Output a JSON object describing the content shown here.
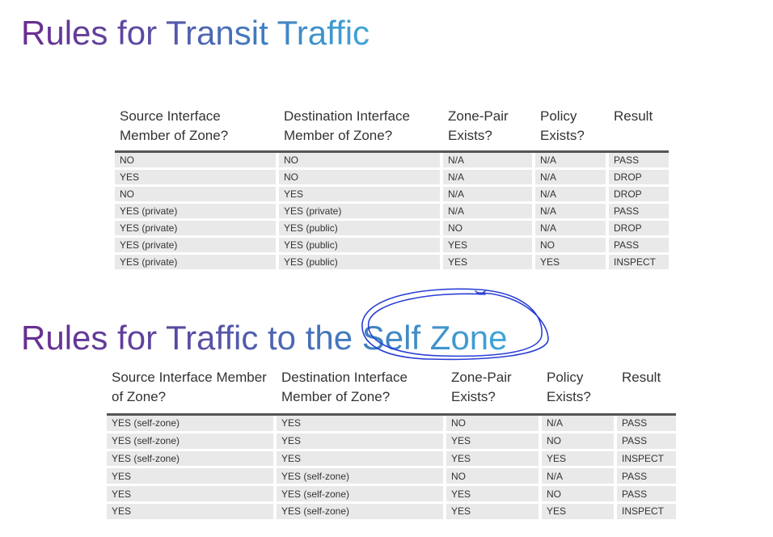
{
  "transit": {
    "title": "Rules for Transit Traffic",
    "headers": [
      "Source Interface Member of Zone?",
      "Destination Interface Member of Zone?",
      "Zone-Pair Exists?",
      "Policy Exists?",
      "Result"
    ],
    "rows": [
      [
        "NO",
        "NO",
        "N/A",
        "N/A",
        "PASS"
      ],
      [
        "YES",
        "NO",
        "N/A",
        "N/A",
        "DROP"
      ],
      [
        "NO",
        "YES",
        "N/A",
        "N/A",
        "DROP"
      ],
      [
        "YES (private)",
        "YES (private)",
        "N/A",
        "N/A",
        "PASS"
      ],
      [
        "YES (private)",
        "YES (public)",
        "NO",
        "N/A",
        "DROP"
      ],
      [
        "YES (private)",
        "YES (public)",
        "YES",
        "NO",
        "PASS"
      ],
      [
        "YES (private)",
        "YES (public)",
        "YES",
        "YES",
        "INSPECT"
      ]
    ]
  },
  "self_zone": {
    "title": "Rules for Traffic to the Self Zone",
    "headers": [
      "Source Interface Member of Zone?",
      "Destination Interface Member of Zone?",
      "Zone-Pair Exists?",
      "Policy Exists?",
      "Result"
    ],
    "rows": [
      [
        "YES (self-zone)",
        "YES",
        "NO",
        "N/A",
        "PASS"
      ],
      [
        "YES (self-zone)",
        "YES",
        "YES",
        "NO",
        "PASS"
      ],
      [
        "YES (self-zone)",
        "YES",
        "YES",
        "YES",
        "INSPECT"
      ],
      [
        "YES",
        "YES (self-zone)",
        "NO",
        "N/A",
        "PASS"
      ],
      [
        "YES",
        "YES (self-zone)",
        "YES",
        "NO",
        "PASS"
      ],
      [
        "YES",
        "YES (self-zone)",
        "YES",
        "YES",
        "INSPECT"
      ]
    ]
  },
  "colors": {
    "title_gradient_start": "#6a2d8f",
    "title_gradient_end": "#3fa6d8",
    "annotation_ink": "#2a3fd6",
    "row_fill": "#e9e9e9"
  }
}
